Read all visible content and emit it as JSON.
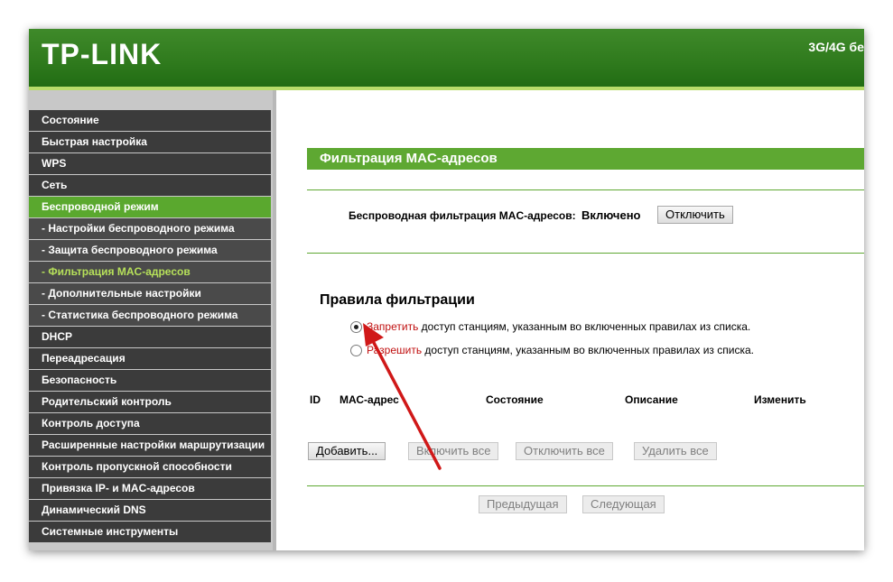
{
  "header": {
    "logo": "TP-LINK",
    "model": "3G/4G бе"
  },
  "sidebar": {
    "items": [
      {
        "label": "Состояние"
      },
      {
        "label": "Быстрая настройка"
      },
      {
        "label": "WPS"
      },
      {
        "label": "Сеть"
      },
      {
        "label": "Беспроводной режим"
      },
      {
        "label": "- Настройки беспроводного режима"
      },
      {
        "label": "- Защита беспроводного режима"
      },
      {
        "label": "- Фильтрация MAC-адресов"
      },
      {
        "label": "- Дополнительные настройки"
      },
      {
        "label": "- Статистика беспроводного режима"
      },
      {
        "label": "DHCP"
      },
      {
        "label": "Переадресация"
      },
      {
        "label": "Безопасность"
      },
      {
        "label": "Родительский контроль"
      },
      {
        "label": "Контроль доступа"
      },
      {
        "label": "Расширенные настройки маршрутизации"
      },
      {
        "label": "Контроль пропускной способности"
      },
      {
        "label": "Привязка IP- и MAC-адресов"
      },
      {
        "label": "Динамический DNS"
      },
      {
        "label": "Системные инструменты"
      }
    ]
  },
  "main": {
    "section_title": "Фильтрация MAC-адресов",
    "filter_label": "Беспроводная фильтрация MAC-адресов:",
    "filter_status": "Включено",
    "disable_button": "Отключить",
    "rules_title": "Правила фильтрации",
    "rule_deny_word": "Запретить",
    "rule_deny_text": "доступ станциям, указанным во включенных правилах из списка.",
    "rule_allow_word": "Разрешить",
    "rule_allow_text": "доступ станциям, указанным во включенных правилах из списка.",
    "table_headers": {
      "id": "ID",
      "mac": "МАС-адрес",
      "state": "Состояние",
      "desc": "Описание",
      "edit": "Изменить"
    },
    "buttons": {
      "add": "Добавить...",
      "enable_all": "Включить все",
      "disable_all": "Отключить все",
      "delete_all": "Удалить все"
    },
    "pager": {
      "prev": "Предыдущая",
      "next": "Следующая"
    }
  },
  "colors": {
    "accent": "#5ea832",
    "sidebar_bg": "#3b3b3b",
    "active_item": "#5aa82e",
    "annotation_arrow": "#d01818"
  }
}
